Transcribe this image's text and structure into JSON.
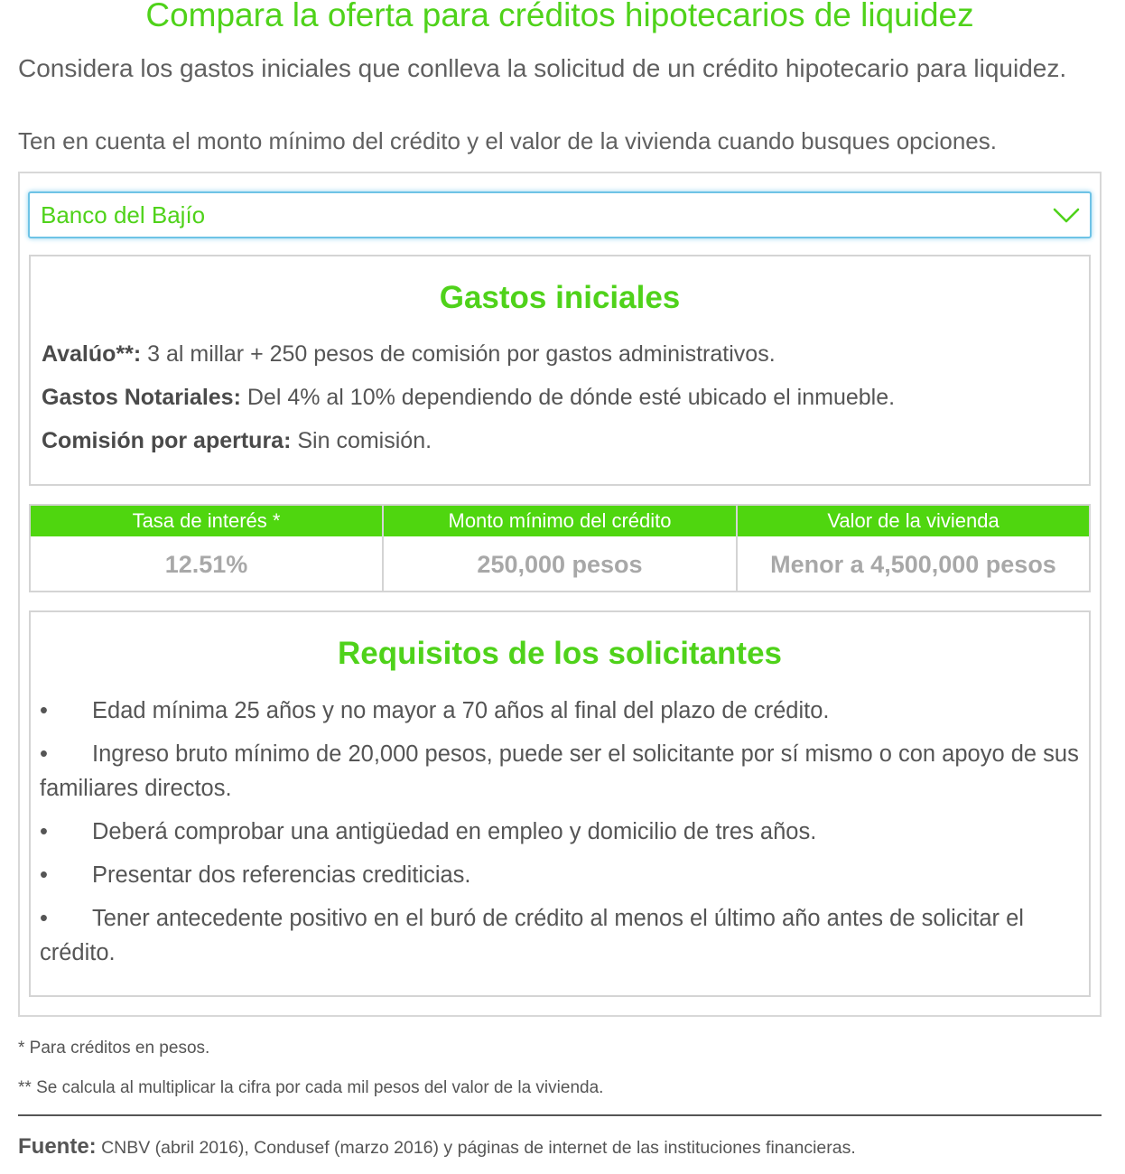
{
  "title": "Compara la oferta para créditos hipotecarios de liquidez",
  "intro": {
    "line1": "Considera los gastos iniciales que conlleva la solicitud de un crédito hipotecario para liquidez.",
    "line2": "Ten en cuenta el monto mínimo del crédito y el valor de la vivienda cuando busques opciones."
  },
  "select": {
    "value": "Banco del Bajío",
    "icon": "chevron-down-icon"
  },
  "gastos": {
    "title": "Gastos iniciales",
    "items": [
      {
        "label": "Avalúo**:",
        "text": " 3 al millar + 250 pesos de comisión por gastos administrativos."
      },
      {
        "label": "Gastos Notariales:",
        "text": " Del 4% al 10% dependiendo de dónde esté ubicado el inmueble."
      },
      {
        "label": "Comisión por apertura:",
        "text": " Sin comisión."
      }
    ]
  },
  "table": {
    "headers": [
      "Tasa de interés *",
      "Monto mínimo del crédito",
      "Valor de la vivienda"
    ],
    "values": [
      "12.51%",
      "250,000 pesos",
      "Menor a 4,500,000 pesos"
    ]
  },
  "requisitos": {
    "title": "Requisitos de los solicitantes",
    "bullet": "•",
    "items": [
      "Edad mínima 25 años y no mayor a 70 años al final del plazo de crédito.",
      "Ingreso bruto mínimo de 20,000 pesos, puede ser el solicitante por sí mismo o con apoyo de sus familiares directos.",
      "Deberá comprobar una antigüedad en empleo y domicilio de tres años.",
      "Presentar dos referencias crediticias.",
      "Tener antecedente positivo en el buró de crédito al menos el último año antes de solicitar el crédito."
    ]
  },
  "footnotes": [
    "* Para créditos en pesos.",
    "** Se calcula al multiplicar la cifra por cada mil pesos del valor de la vivienda."
  ],
  "source": {
    "label": "Fuente:",
    "text": " CNBV (abril 2016), Condusef (marzo 2016) y páginas de internet de las instituciones financieras."
  },
  "colors": {
    "accent": "#4fd21a",
    "header_bg": "#4fd60f",
    "select_border": "#6ec3e6"
  }
}
